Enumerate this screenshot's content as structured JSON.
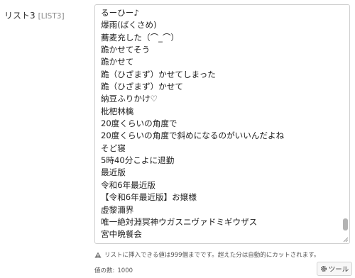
{
  "field": {
    "label": "リスト3",
    "key": "[LIST3]"
  },
  "list_lines": [
    "るーひー♪",
    "爆雨(ばくさめ)",
    "蕎麦充した（⌒_⌒）",
    "跪かせてそう",
    "跪かせて",
    "跪（ひざまず）かせてしまった",
    "跪（ひざまず）かせて",
    "納豆ふりかけ♡",
    "枇杷林檎",
    "20度くらいの角度で",
    "20度くらいの角度で斜めになるのがいいんだよね",
    "そど寝",
    "5時40分こよに退勤",
    "最近版",
    "令和6年最近版",
    "【令和6年最近版】お嬢様",
    "虚黎濔界",
    "唯一絶対淵冥神ウガスニヴァドミギウザス",
    "宮中晩餐会"
  ],
  "scrollbar": {
    "thumb_position": 0.94,
    "thumb_size": 0.05
  },
  "notice": {
    "text": "リストに挿入できる値は999個までです。超えた分は自動的にカットされます。",
    "icon": "warning-icon"
  },
  "count": {
    "label": "値の数:",
    "value": "1000"
  },
  "tool_button": {
    "label": "ツール",
    "icon": "gear-icon"
  },
  "colors": {
    "border": "#cfcfcf",
    "scroll_thumb": "#b3b3b3",
    "warning_icon": "#7a7a7a"
  }
}
